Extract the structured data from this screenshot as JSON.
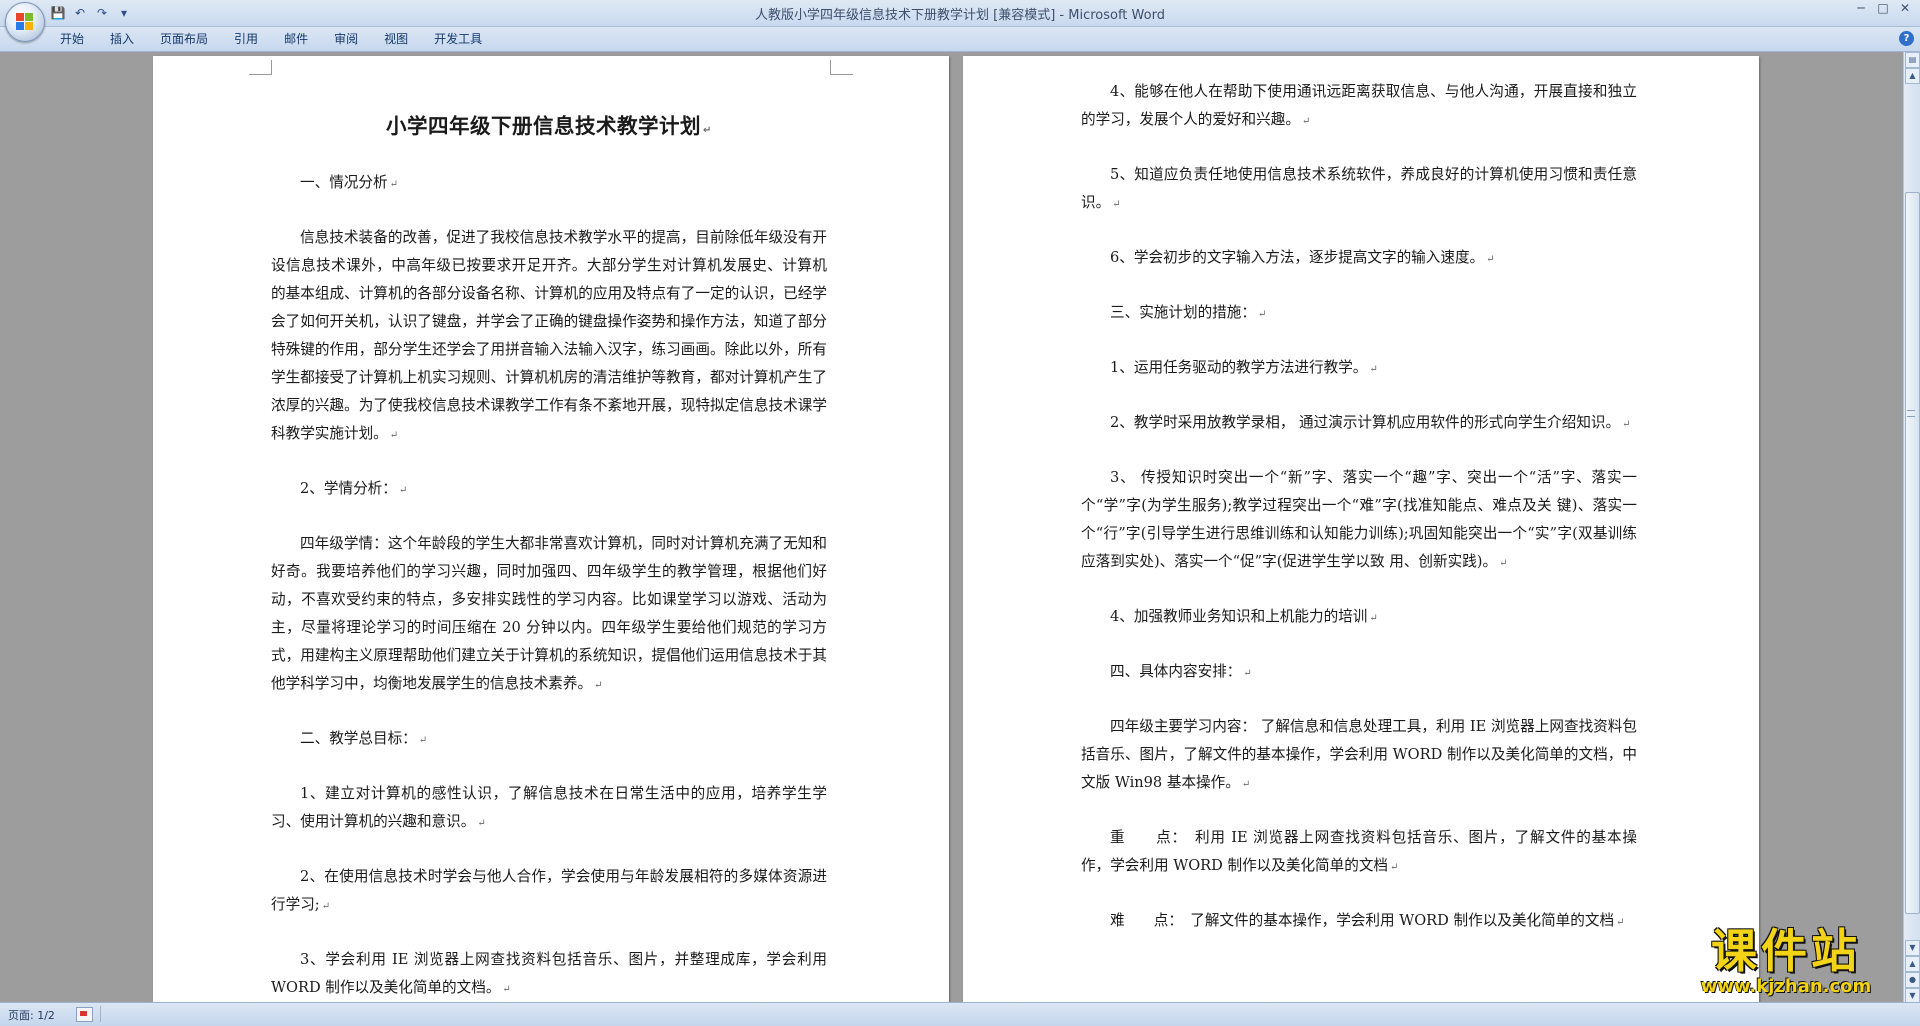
{
  "window": {
    "title": "人教版小学四年级信息技术下册教学计划 [兼容模式] - Microsoft Word",
    "controls": {
      "minimize": "─",
      "maximize": "□",
      "close": "✕"
    }
  },
  "qat": {
    "save": "💾",
    "undo": "↶",
    "redo": "↷",
    "customize": "▾"
  },
  "ribbon": {
    "tabs": [
      "开始",
      "插入",
      "页面布局",
      "引用",
      "邮件",
      "审阅",
      "视图",
      "开发工具"
    ],
    "help": "?"
  },
  "page1": {
    "title": "小学四年级下册信息技术教学计划",
    "paragraphs": [
      "一、情况分析",
      "信息技术装备的改善，促进了我校信息技术教学水平的提高，目前除低年级没有开设信息技术课外，中高年级已按要求开足开齐。大部分学生对计算机发展史、计算机 的基本组成、计算机的各部分设备名称、计算机的应用及特点有了一定的认识，已经学会了如何开关机，认识了键盘，并学会了正确的键盘操作姿势和操作方法，知道了部分特殊键的作用，部分学生还学会了用拼音输入法输入汉字，练习画画。除此以外，所有学生都接受了计算机上机实习规则、计算机机房的清洁维护等教育，都对计算机产生了浓厚的兴趣。为了使我校信息技术课教学工作有条不紊地开展，现特拟定信息技术课学科教学实施计划。",
      "2、学情分析：",
      "四年级学情：这个年龄段的学生大都非常喜欢计算机，同时对计算机充满了无知和好奇。我要培养他们的学习兴趣，同时加强四、四年级学生的教学管理，根据他们好动，不喜欢受约束的特点，多安排实践性的学习内容。比如课堂学习以游戏、活动为主，尽量将理论学习的时间压缩在 20 分钟以内。四年级学生要给他们规范的学习方式，用建构主义原理帮助他们建立关于计算机的系统知识，提倡他们运用信息技术于其他学科学习中，均衡地发展学生的信息技术素养。",
      "二、教学总目标：",
      "1、建立对计算机的感性认识，了解信息技术在日常生活中的应用，培养学生学习、使用计算机的兴趣和意识。",
      "2、在使用信息技术时学会与他人合作，学会使用与年龄发展相符的多媒体资源进行学习;",
      "3、学会利用 IE 浏览器上网查找资料包括音乐、图片，并整理成库，学会利用 WORD 制作以及美化简单的文档。"
    ]
  },
  "page2": {
    "paragraphs": [
      "4、能够在他人在帮助下使用通讯远距离获取信息、与他人沟通，开展直接和独立的学习，发展个人的爱好和兴趣。",
      "5、知道应负责任地使用信息技术系统软件，养成良好的计算机使用习惯和责任意识。",
      "6、学会初步的文字输入方法，逐步提高文字的输入速度。",
      "三、实施计划的措施：",
      "1、运用任务驱动的教学方法进行教学。",
      "2、教学时采用放教学录相， 通过演示计算机应用软件的形式向学生介绍知识。",
      "3、 传授知识时突出一个“新”字、落实一个“趣”字、突出一个“活”字、落实一个“学”字(为学生服务);教学过程突出一个“难”字(找准知能点、难点及关 键)、落实一个“行”字(引导学生进行思维训练和认知能力训练);巩固知能突出一个“实”字(双基训练应落到实处)、落实一个“促”字(促进学生学以致 用、创新实践)。",
      "4、加强教师业务知识和上机能力的培训",
      "四、具体内容安排：",
      "四年级主要学习内容： 了解信息和信息处理工具，利用 IE 浏览器上网查找资料包括音乐、图片，了解文件的基本操作，学会利用 WORD 制作以及美化简单的文档，中文版 Win98 基本操作。",
      "重　　点：　利用 IE 浏览器上网查找资料包括音乐、图片，了解文件的基本操作，学会利用 WORD 制作以及美化简单的文档",
      "难　　点：　了解文件的基本操作，学会利用 WORD 制作以及美化简单的文档"
    ]
  },
  "paragraph_mark": "↵",
  "statusbar": {
    "page": "页面: 1/2"
  },
  "watermark": {
    "main": "课件站",
    "url": "www.kjzhan.com"
  },
  "colors": {
    "workspace": "#9d9d9d",
    "ribbon": "#c7d8ee",
    "watermark": "#f2d316"
  }
}
